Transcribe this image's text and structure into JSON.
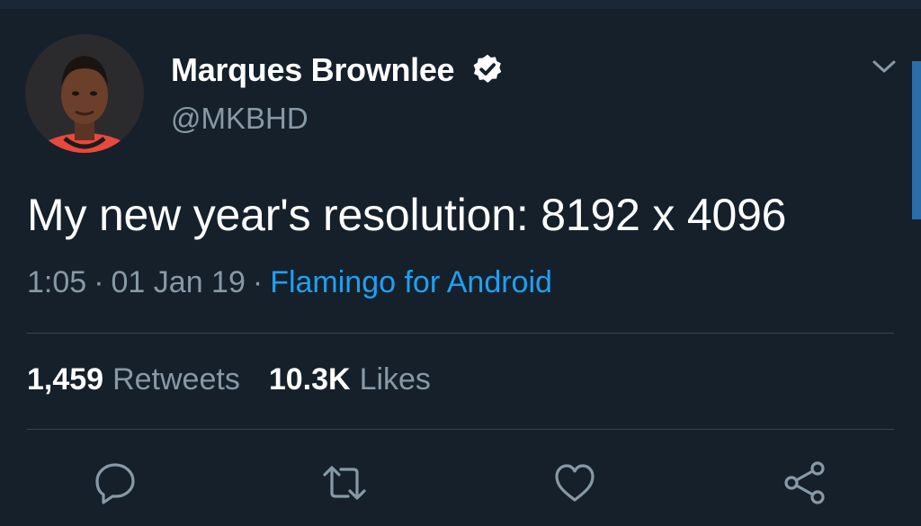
{
  "tweet": {
    "author": {
      "name": "Marques Brownlee",
      "handle": "@MKBHD",
      "verified": true
    },
    "text": "My new year's resolution: 8192 x 4096",
    "time": "1:05",
    "date": "01 Jan 19",
    "separator": "·",
    "source": "Flamingo for Android",
    "stats": {
      "retweets_count": "1,459",
      "retweets_label": "Retweets",
      "likes_count": "10.3K",
      "likes_label": "Likes"
    }
  },
  "actions": [
    "reply-icon",
    "retweet-icon",
    "like-icon",
    "share-icon"
  ],
  "colors": {
    "background": "#15202b",
    "text_primary": "#ffffff",
    "text_secondary": "#8899a6",
    "link": "#1da1f2",
    "divider": "#38444d"
  }
}
